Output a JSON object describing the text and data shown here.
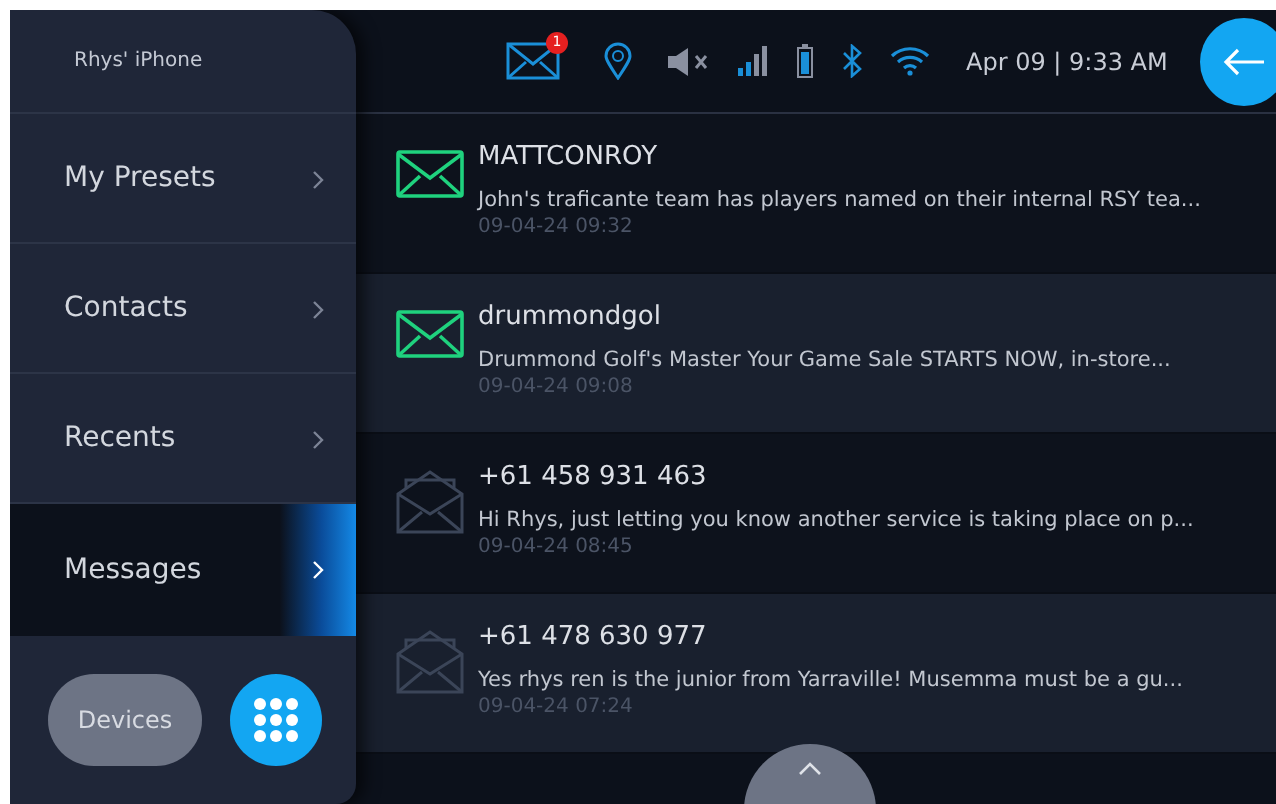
{
  "sidebar": {
    "device_name": "Rhys' iPhone",
    "items": [
      {
        "label": "My Presets",
        "selected": false
      },
      {
        "label": "Contacts",
        "selected": false
      },
      {
        "label": "Recents",
        "selected": false
      },
      {
        "label": "Messages",
        "selected": true
      }
    ],
    "devices_button": "Devices"
  },
  "status_bar": {
    "message_badge": "1",
    "datetime": "Apr 09 | 9:33 AM"
  },
  "messages": [
    {
      "sender": "MATTCONROY",
      "preview": "John's traficante team has players named on their internal RSY tea...",
      "time": "09-04-24 09:32",
      "read": false
    },
    {
      "sender": "drummondgol",
      "preview": "Drummond Golf's Master Your Game Sale STARTS NOW, in-store...",
      "time": "09-04-24 09:08",
      "read": false
    },
    {
      "sender": "+61 458 931 463",
      "preview": "Hi Rhys, just letting you know another service is taking place on p...",
      "time": "09-04-24 08:45",
      "read": true
    },
    {
      "sender": "+61 478 630 977",
      "preview": "Yes rhys ren is the junior from Yarraville! Musemma must be a gu...",
      "time": "09-04-24 07:24",
      "read": true
    }
  ]
}
